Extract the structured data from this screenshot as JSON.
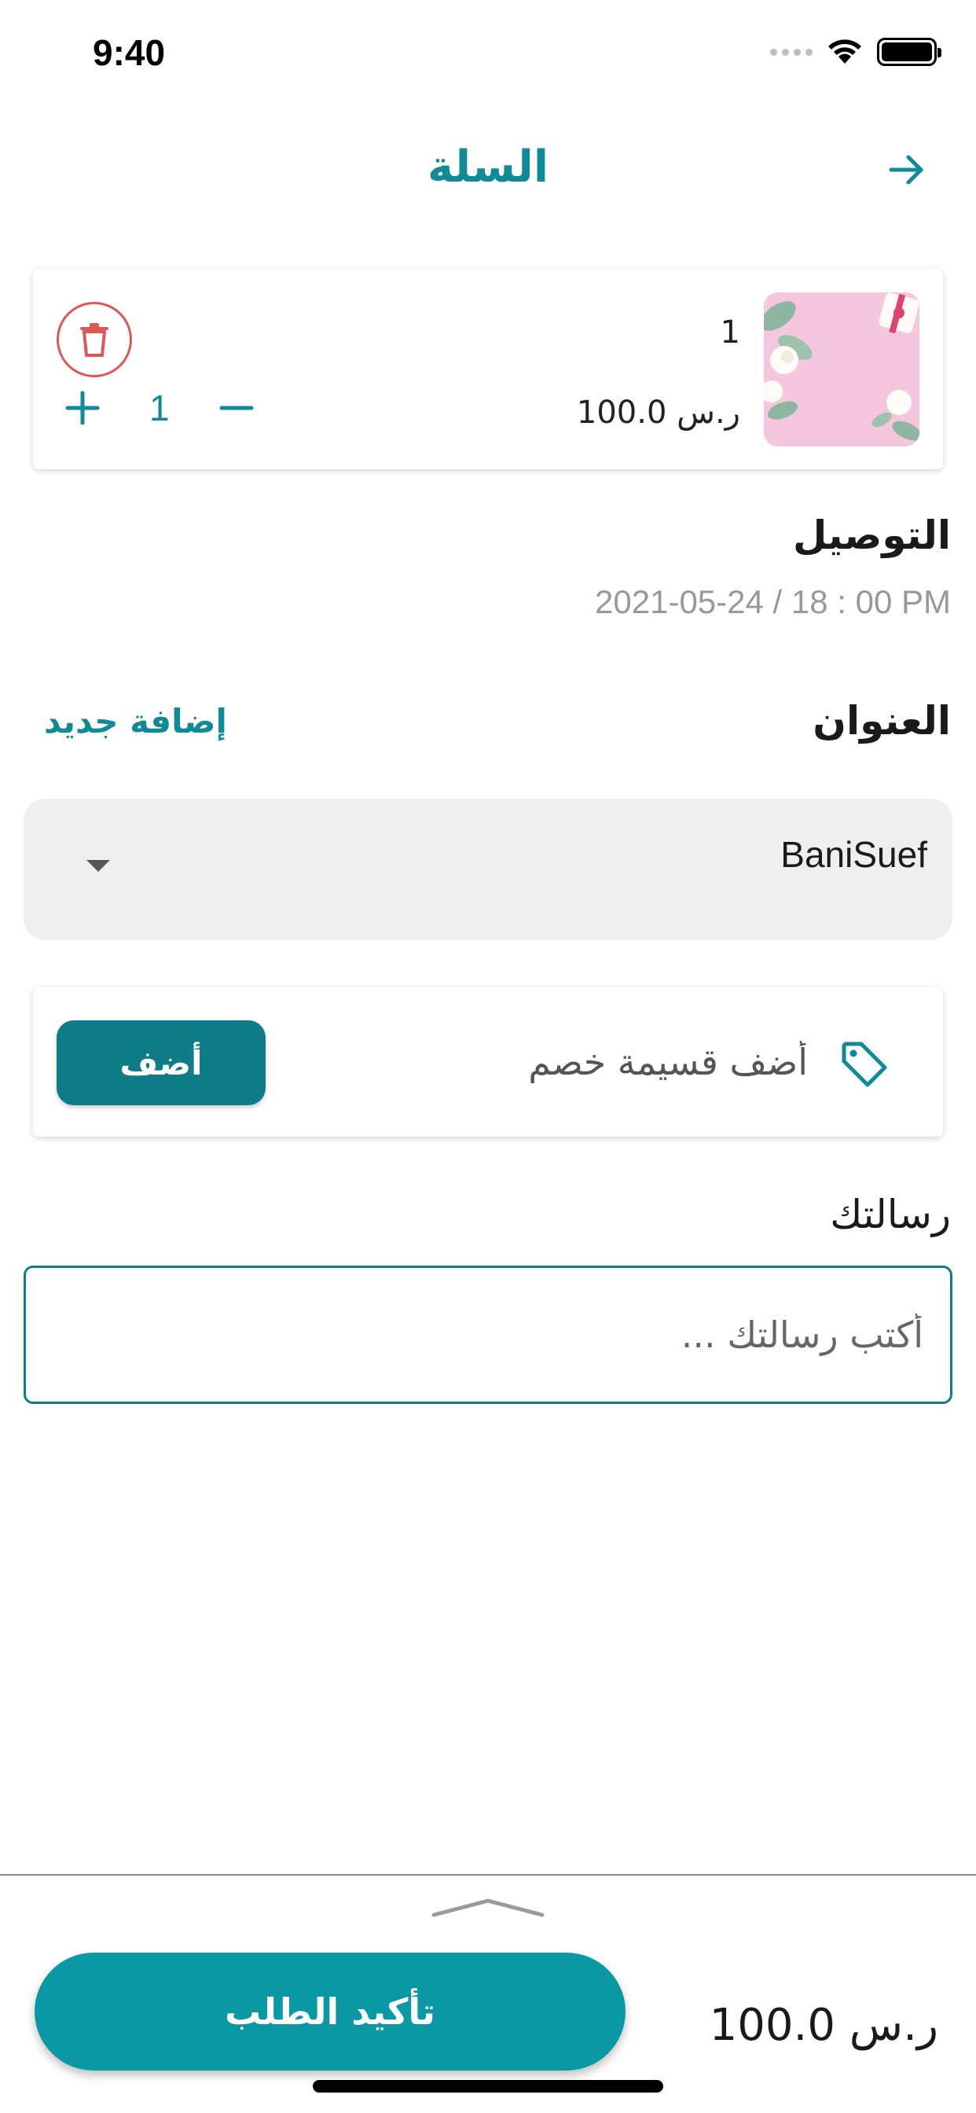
{
  "status_bar": {
    "time": "9:40"
  },
  "header": {
    "title": "السلة",
    "back_icon": "arrow-right-icon"
  },
  "cart_item": {
    "name": "1",
    "price": "100.0 ر.س",
    "quantity": "1",
    "delete_icon": "trash-icon",
    "plus_icon": "plus-icon",
    "minus_icon": "minus-icon"
  },
  "delivery": {
    "title": "التوصيل",
    "datetime": "2021-05-24 / 18 : 00 PM"
  },
  "address": {
    "title": "العنوان",
    "add_new": "إضافة جديد",
    "selected": "BaniSuef"
  },
  "coupon": {
    "placeholder": "أضف قسيمة خصم",
    "apply_label": "أضف",
    "icon": "tag-icon"
  },
  "message": {
    "title": "رسالتك",
    "placeholder": "أكتب رسالتك ..."
  },
  "footer": {
    "total": "100.0 ر.س",
    "confirm_label": "تأكيد الطلب"
  },
  "colors": {
    "primary": "#0f8b98",
    "button": "#0f7d88",
    "confirm": "#0b98a5",
    "delete": "#e05656"
  }
}
